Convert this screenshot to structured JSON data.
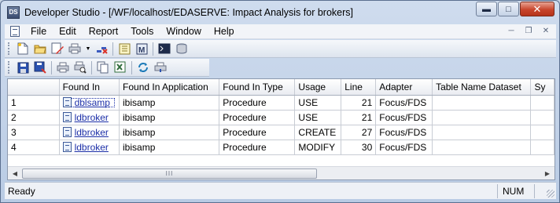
{
  "window": {
    "app_icon_text": "DS",
    "title": "Developer Studio - [/WF/localhost/EDASERVE: Impact Analysis for brokers]"
  },
  "menu": {
    "items": [
      "File",
      "Edit",
      "Report",
      "Tools",
      "Window",
      "Help"
    ]
  },
  "grid": {
    "columns": [
      "",
      "Found In",
      "Found In Application",
      "Found In Type",
      "Usage",
      "Line",
      "Adapter",
      "Table Name Dataset",
      "Sy"
    ],
    "rows": [
      {
        "index": "1",
        "found_in": "dblsamp",
        "app": "ibisamp",
        "type": "Procedure",
        "usage": "USE",
        "line": "21",
        "adapter": "Focus/FDS",
        "table": ""
      },
      {
        "index": "2",
        "found_in": "ldbroker",
        "app": "ibisamp",
        "type": "Procedure",
        "usage": "USE",
        "line": "21",
        "adapter": "Focus/FDS",
        "table": ""
      },
      {
        "index": "3",
        "found_in": "ldbroker",
        "app": "ibisamp",
        "type": "Procedure",
        "usage": "CREATE",
        "line": "27",
        "adapter": "Focus/FDS",
        "table": ""
      },
      {
        "index": "4",
        "found_in": "ldbroker",
        "app": "ibisamp",
        "type": "Procedure",
        "usage": "MODIFY",
        "line": "30",
        "adapter": "Focus/FDS",
        "table": ""
      }
    ],
    "scroll_thumb_label": "III"
  },
  "status": {
    "text": "Ready",
    "num": "NUM"
  },
  "colors": {
    "link": "#1c2fa8",
    "title_bar": "#c4d3e8",
    "close_button": "#c8452c"
  }
}
